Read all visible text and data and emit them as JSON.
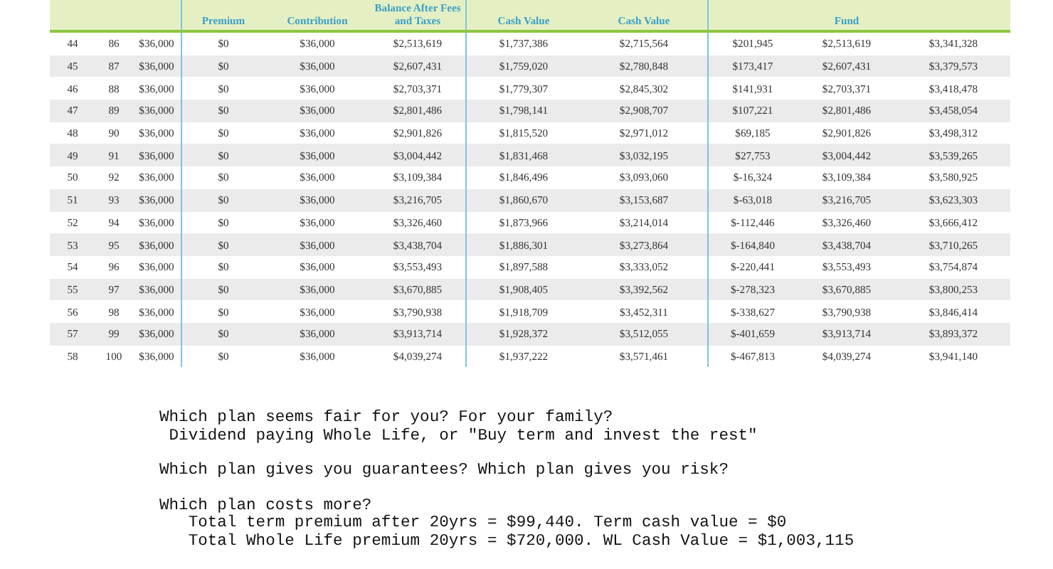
{
  "table": {
    "columns": [
      {
        "divider_after": false
      },
      {
        "divider_after": false
      },
      {
        "divider_after": true
      },
      {
        "label": "Premium",
        "divider_after": false
      },
      {
        "label": "Contribution",
        "divider_after": false
      },
      {
        "label": "Balance After Fees and Taxes",
        "divider_after": true
      },
      {
        "label": "Cash Value",
        "divider_after": false
      },
      {
        "label": "Cash Value",
        "divider_after": true
      },
      {
        "divider_after": false
      },
      {
        "label": "Fund",
        "divider_after": false
      },
      {
        "divider_after": false
      }
    ],
    "rows": [
      [
        "44",
        "86",
        "$36,000",
        "$0",
        "$36,000",
        "$2,513,619",
        "$1,737,386",
        "$2,715,564",
        "$201,945",
        "$2,513,619",
        "$3,341,328"
      ],
      [
        "45",
        "87",
        "$36,000",
        "$0",
        "$36,000",
        "$2,607,431",
        "$1,759,020",
        "$2,780,848",
        "$173,417",
        "$2,607,431",
        "$3,379,573"
      ],
      [
        "46",
        "88",
        "$36,000",
        "$0",
        "$36,000",
        "$2,703,371",
        "$1,779,307",
        "$2,845,302",
        "$141,931",
        "$2,703,371",
        "$3,418,478"
      ],
      [
        "47",
        "89",
        "$36,000",
        "$0",
        "$36,000",
        "$2,801,486",
        "$1,798,141",
        "$2,908,707",
        "$107,221",
        "$2,801,486",
        "$3,458,054"
      ],
      [
        "48",
        "90",
        "$36,000",
        "$0",
        "$36,000",
        "$2,901,826",
        "$1,815,520",
        "$2,971,012",
        "$69,185",
        "$2,901,826",
        "$3,498,312"
      ],
      [
        "49",
        "91",
        "$36,000",
        "$0",
        "$36,000",
        "$3,004,442",
        "$1,831,468",
        "$3,032,195",
        "$27,753",
        "$3,004,442",
        "$3,539,265"
      ],
      [
        "50",
        "92",
        "$36,000",
        "$0",
        "$36,000",
        "$3,109,384",
        "$1,846,496",
        "$3,093,060",
        "$-16,324",
        "$3,109,384",
        "$3,580,925"
      ],
      [
        "51",
        "93",
        "$36,000",
        "$0",
        "$36,000",
        "$3,216,705",
        "$1,860,670",
        "$3,153,687",
        "$-63,018",
        "$3,216,705",
        "$3,623,303"
      ],
      [
        "52",
        "94",
        "$36,000",
        "$0",
        "$36,000",
        "$3,326,460",
        "$1,873,966",
        "$3,214,014",
        "$-112,446",
        "$3,326,460",
        "$3,666,412"
      ],
      [
        "53",
        "95",
        "$36,000",
        "$0",
        "$36,000",
        "$3,438,704",
        "$1,886,301",
        "$3,273,864",
        "$-164,840",
        "$3,438,704",
        "$3,710,265"
      ],
      [
        "54",
        "96",
        "$36,000",
        "$0",
        "$36,000",
        "$3,553,493",
        "$1,897,588",
        "$3,333,052",
        "$-220,441",
        "$3,553,493",
        "$3,754,874"
      ],
      [
        "55",
        "97",
        "$36,000",
        "$0",
        "$36,000",
        "$3,670,885",
        "$1,908,405",
        "$3,392,562",
        "$-278,323",
        "$3,670,885",
        "$3,800,253"
      ],
      [
        "56",
        "98",
        "$36,000",
        "$0",
        "$36,000",
        "$3,790,938",
        "$1,918,709",
        "$3,452,311",
        "$-338,627",
        "$3,790,938",
        "$3,846,414"
      ],
      [
        "57",
        "99",
        "$36,000",
        "$0",
        "$36,000",
        "$3,913,714",
        "$1,928,372",
        "$3,512,055",
        "$-401,659",
        "$3,913,714",
        "$3,893,372"
      ],
      [
        "58",
        "100",
        "$36,000",
        "$0",
        "$36,000",
        "$4,039,274",
        "$1,937,222",
        "$3,571,461",
        "$-467,813",
        "$4,039,274",
        "$3,941,140"
      ]
    ]
  },
  "notes": [
    {
      "lines": [
        "Which plan seems fair for you? For your family?",
        " Dividend paying Whole Life, or \"Buy term and invest the rest\""
      ]
    },
    {
      "lines": [
        "Which plan gives you guarantees? Which plan gives you risk?"
      ]
    },
    {
      "lines": [
        "Which plan costs more?",
        "   Total term premium after 20yrs = $99,440. Term cash value = $0",
        "   Total Whole Life premium 20yrs = $720,000. WL Cash Value = $1,003,115"
      ]
    }
  ]
}
